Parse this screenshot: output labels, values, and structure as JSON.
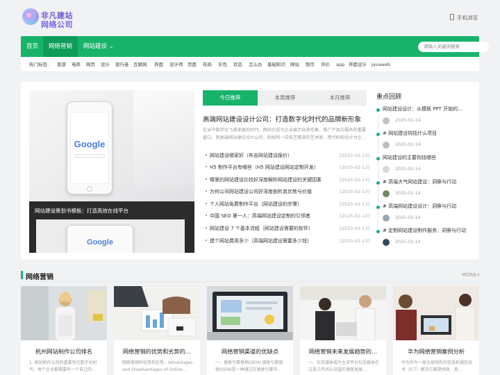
{
  "header": {
    "logo_line1": "非凡建站",
    "logo_line2": "网络公司",
    "mobile_label": "手机浏览"
  },
  "nav": {
    "items": [
      "首页",
      "网络营销",
      "网站建设"
    ],
    "dropdown_caret": "⌄",
    "search_placeholder": "请输入关键词搜索"
  },
  "tags": {
    "label": "热门标签:",
    "items": [
      "旅游",
      "电商",
      "网页",
      "设计",
      "旅行者",
      "互联网",
      "界面",
      "设计师",
      "页面",
      "布局",
      "灰色",
      "状态",
      "怎么办",
      "基础知识",
      "网站",
      "制作",
      "评价",
      "app",
      "界面设计",
      "javaweb"
    ]
  },
  "slider": {
    "caption": "网站建设策划书模板：打造高效在线平台",
    "logo_text": "Google"
  },
  "tabs": [
    "今日推荐",
    "本周推荐",
    "本月推荐"
  ],
  "featured": {
    "title": "高端网站建设设计公司：打造数字化时代的品牌新形象",
    "summary": "在当今数字化飞速发展的时代，网站已成为企业展示自身形象、推广产品与服务的重要窗口。而高端网站建设设计公司，则如同一位技艺精湛的艺术家，用代码和设计为企…"
  },
  "articles": [
    {
      "title": "网站建设哪家好（布吉网站建设报价）",
      "date": "[2025-02-13]"
    },
    {
      "title": "H5 制作平台有哪些（H5 网站建设网站定制开发）",
      "date": "[2025-02-13]"
    },
    {
      "title": "哪里的网站建设比较好深度解析网站建设的关键因素",
      "date": "[2025-02-13]"
    },
    {
      "title": "为何公司网站建设公司好深度剖析其优势与价值",
      "date": "[2025-02-13]"
    },
    {
      "title": "个人网站免费制作平台（网站建设的步骤）",
      "date": "[2025-02-13]"
    },
    {
      "title": "中国 SEO 第一人：高端网站建设定制的引领者",
      "date": "[2025-02-13]"
    },
    {
      "title": "网站建设 7 个基本流程（网站建设需要的软件）",
      "date": "[2025-02-13]"
    },
    {
      "title": "建个网站费用多少（高端网站建设需要多少钱）",
      "date": "[2025-02-13]"
    }
  ],
  "review": {
    "title": "重点回顾",
    "items": [
      {
        "title": "网站建设设计：从模板 PPT 开始的…",
        "date": "2025-02-14"
      },
      {
        "title": "# 网站建设钩括什么项目",
        "date": "2025-02-14"
      },
      {
        "title": "网站建设的主要钩括哪些",
        "date": "2025-02-14"
      },
      {
        "title": "# 高端大气网站建设：洞察与行动",
        "date": "2025-02-14"
      },
      {
        "title": "# 高端网站建设设计：洞察与行动",
        "date": "2025-02-14"
      },
      {
        "title": "# 定制网站建设制作服务：洞察与行动",
        "date": "2025-02-14"
      }
    ]
  },
  "section": {
    "title": "网络营销",
    "more": "MORE+"
  },
  "cards": [
    {
      "title": "杭州网站制作公司排名",
      "desc": "1. 网站制作公司的重要性在数字化时代，每个企业都需要有一个自己的…"
    },
    {
      "title": "网络营销的优势和劣势的…",
      "desc": "网络营销的优势和劣势：Advantages and Disadvantages of Online…"
    },
    {
      "title": "网络营销渠道的优缺点",
      "desc": "一、搜索引擎营销(SEM) 搜索引擎营销(SEM)是一种通过在搜索引擎中…"
    },
    {
      "title": "网络营销未来发展趋势的…",
      "desc": "一、社交媒体成为主流平台社交媒体在过去几年间以迅猛的速度发展…"
    },
    {
      "title": "华为网络营销案例分析",
      "desc": "华为作为一家全球领先的信息和通信技术（ICT）解决方案提供商，其…"
    }
  ]
}
